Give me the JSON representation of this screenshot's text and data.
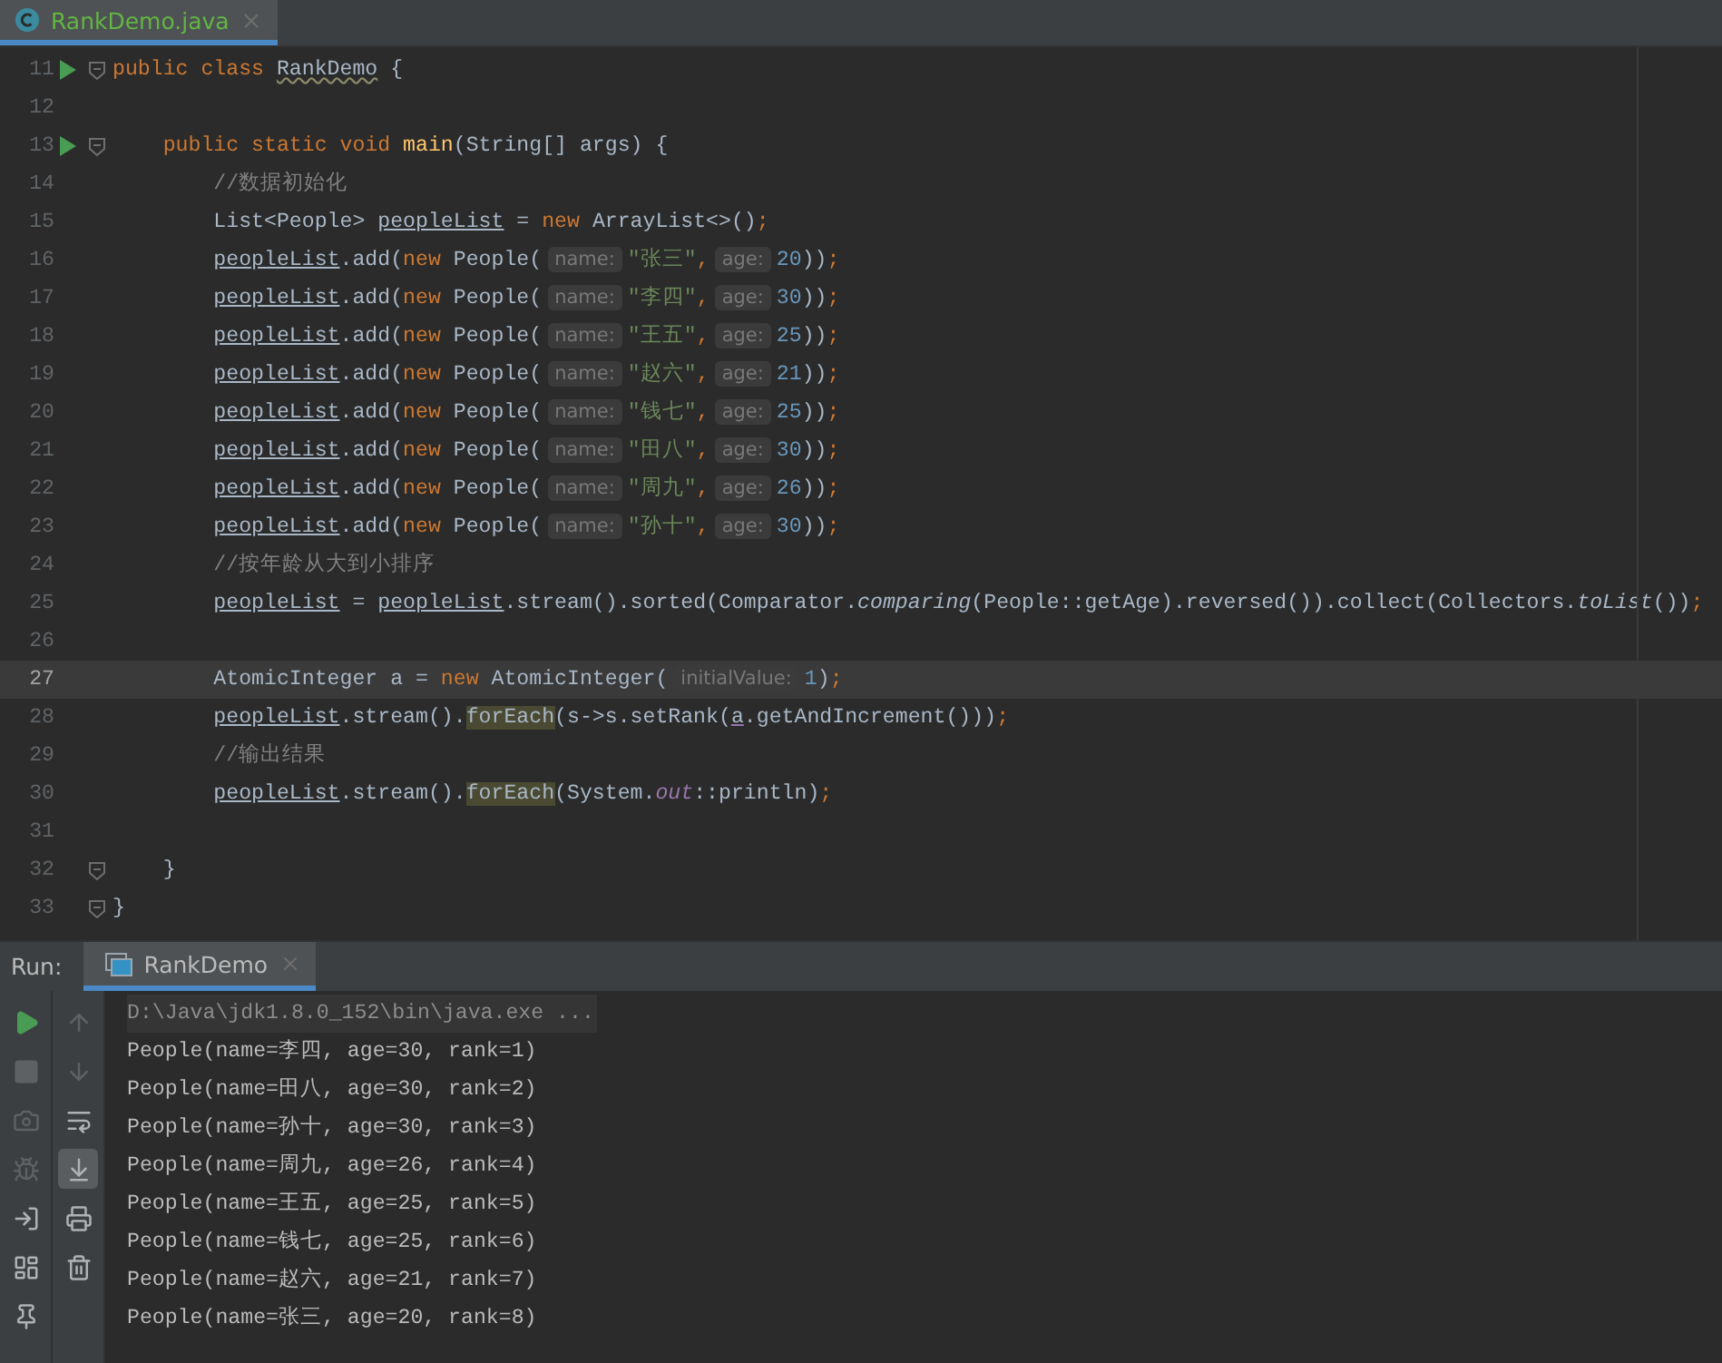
{
  "editor_tabs": [
    {
      "label": "RankDemo.java",
      "selected": true
    }
  ],
  "code_lines": [
    {
      "number": "11",
      "run": true,
      "fold": true,
      "current": false,
      "tokens": [
        {
          "kind": "kw",
          "text": "public class "
        },
        {
          "kind": "warn",
          "text": "RankDemo"
        },
        {
          "kind": "plain",
          "text": " {"
        }
      ]
    },
    {
      "number": "12",
      "run": false,
      "fold": false,
      "current": false
    },
    {
      "number": "13",
      "run": true,
      "fold": true,
      "current": false,
      "tokens": [
        {
          "kind": "kw",
          "text": "    public static void "
        },
        {
          "kind": "decl",
          "text": "main"
        },
        {
          "kind": "plain",
          "text": "(String[] args) {"
        }
      ]
    },
    {
      "number": "14",
      "run": false,
      "fold": false,
      "current": false,
      "tokens": [
        {
          "kind": "comment",
          "text": "        //数据初始化"
        }
      ]
    },
    {
      "number": "15",
      "run": false,
      "fold": false,
      "current": false,
      "tokens": [
        {
          "kind": "plain",
          "text": "        List<People> "
        },
        {
          "kind": "field",
          "text": "peopleList"
        },
        {
          "kind": "plain",
          "text": " = "
        },
        {
          "kind": "kw",
          "text": "new "
        },
        {
          "kind": "plain",
          "text": "ArrayList<>()"
        },
        {
          "kind": "kw",
          "text": ";"
        }
      ]
    },
    {
      "number": "16",
      "run": false,
      "fold": false,
      "current": false,
      "tokens": [
        {
          "kind": "field",
          "text": "        peopleList"
        },
        {
          "kind": "plain",
          "text": ".add("
        },
        {
          "kind": "kw",
          "text": "new "
        },
        {
          "kind": "plain",
          "text": "People("
        },
        {
          "kind": "hint",
          "text": "name:"
        },
        {
          "kind": "str",
          "text": "\"张三\""
        },
        {
          "kind": "kw",
          "text": ","
        },
        {
          "kind": "hint",
          "text": "age:"
        },
        {
          "kind": "num",
          "text": "20"
        },
        {
          "kind": "plain",
          "text": "))"
        },
        {
          "kind": "kw",
          "text": ";"
        }
      ]
    },
    {
      "number": "17",
      "run": false,
      "fold": false,
      "current": false,
      "tokens": [
        {
          "kind": "field",
          "text": "        peopleList"
        },
        {
          "kind": "plain",
          "text": ".add("
        },
        {
          "kind": "kw",
          "text": "new "
        },
        {
          "kind": "plain",
          "text": "People("
        },
        {
          "kind": "hint",
          "text": "name:"
        },
        {
          "kind": "str",
          "text": "\"李四\""
        },
        {
          "kind": "kw",
          "text": ","
        },
        {
          "kind": "hint",
          "text": "age:"
        },
        {
          "kind": "num",
          "text": "30"
        },
        {
          "kind": "plain",
          "text": "))"
        },
        {
          "kind": "kw",
          "text": ";"
        }
      ]
    },
    {
      "number": "18",
      "run": false,
      "fold": false,
      "current": false,
      "tokens": [
        {
          "kind": "field",
          "text": "        peopleList"
        },
        {
          "kind": "plain",
          "text": ".add("
        },
        {
          "kind": "kw",
          "text": "new "
        },
        {
          "kind": "plain",
          "text": "People("
        },
        {
          "kind": "hint",
          "text": "name:"
        },
        {
          "kind": "str",
          "text": "\"王五\""
        },
        {
          "kind": "kw",
          "text": ","
        },
        {
          "kind": "hint",
          "text": "age:"
        },
        {
          "kind": "num",
          "text": "25"
        },
        {
          "kind": "plain",
          "text": "))"
        },
        {
          "kind": "kw",
          "text": ";"
        }
      ]
    },
    {
      "number": "19",
      "run": false,
      "fold": false,
      "current": false,
      "tokens": [
        {
          "kind": "field",
          "text": "        peopleList"
        },
        {
          "kind": "plain",
          "text": ".add("
        },
        {
          "kind": "kw",
          "text": "new "
        },
        {
          "kind": "plain",
          "text": "People("
        },
        {
          "kind": "hint",
          "text": "name:"
        },
        {
          "kind": "str",
          "text": "\"赵六\""
        },
        {
          "kind": "kw",
          "text": ","
        },
        {
          "kind": "hint",
          "text": "age:"
        },
        {
          "kind": "num",
          "text": "21"
        },
        {
          "kind": "plain",
          "text": "))"
        },
        {
          "kind": "kw",
          "text": ";"
        }
      ]
    },
    {
      "number": "20",
      "run": false,
      "fold": false,
      "current": false,
      "tokens": [
        {
          "kind": "field",
          "text": "        peopleList"
        },
        {
          "kind": "plain",
          "text": ".add("
        },
        {
          "kind": "kw",
          "text": "new "
        },
        {
          "kind": "plain",
          "text": "People("
        },
        {
          "kind": "hint",
          "text": "name:"
        },
        {
          "kind": "str",
          "text": "\"钱七\""
        },
        {
          "kind": "kw",
          "text": ","
        },
        {
          "kind": "hint",
          "text": "age:"
        },
        {
          "kind": "num",
          "text": "25"
        },
        {
          "kind": "plain",
          "text": "))"
        },
        {
          "kind": "kw",
          "text": ";"
        }
      ]
    },
    {
      "number": "21",
      "run": false,
      "fold": false,
      "current": false,
      "tokens": [
        {
          "kind": "field",
          "text": "        peopleList"
        },
        {
          "kind": "plain",
          "text": ".add("
        },
        {
          "kind": "kw",
          "text": "new "
        },
        {
          "kind": "plain",
          "text": "People("
        },
        {
          "kind": "hint",
          "text": "name:"
        },
        {
          "kind": "str",
          "text": "\"田八\""
        },
        {
          "kind": "kw",
          "text": ","
        },
        {
          "kind": "hint",
          "text": "age:"
        },
        {
          "kind": "num",
          "text": "30"
        },
        {
          "kind": "plain",
          "text": "))"
        },
        {
          "kind": "kw",
          "text": ";"
        }
      ]
    },
    {
      "number": "22",
      "run": false,
      "fold": false,
      "current": false,
      "tokens": [
        {
          "kind": "field",
          "text": "        peopleList"
        },
        {
          "kind": "plain",
          "text": ".add("
        },
        {
          "kind": "kw",
          "text": "new "
        },
        {
          "kind": "plain",
          "text": "People("
        },
        {
          "kind": "hint",
          "text": "name:"
        },
        {
          "kind": "str",
          "text": "\"周九\""
        },
        {
          "kind": "kw",
          "text": ","
        },
        {
          "kind": "hint",
          "text": "age:"
        },
        {
          "kind": "num",
          "text": "26"
        },
        {
          "kind": "plain",
          "text": "))"
        },
        {
          "kind": "kw",
          "text": ";"
        }
      ]
    },
    {
      "number": "23",
      "run": false,
      "fold": false,
      "current": false,
      "tokens": [
        {
          "kind": "field",
          "text": "        peopleList"
        },
        {
          "kind": "plain",
          "text": ".add("
        },
        {
          "kind": "kw",
          "text": "new "
        },
        {
          "kind": "plain",
          "text": "People("
        },
        {
          "kind": "hint",
          "text": "name:"
        },
        {
          "kind": "str",
          "text": "\"孙十\""
        },
        {
          "kind": "kw",
          "text": ","
        },
        {
          "kind": "hint",
          "text": "age:"
        },
        {
          "kind": "num",
          "text": "30"
        },
        {
          "kind": "plain",
          "text": "))"
        },
        {
          "kind": "kw",
          "text": ";"
        }
      ]
    },
    {
      "number": "24",
      "run": false,
      "fold": false,
      "current": false,
      "tokens": [
        {
          "kind": "comment",
          "text": "        //按年龄从大到小排序"
        }
      ]
    },
    {
      "number": "25",
      "run": false,
      "fold": false,
      "current": false,
      "tokens": [
        {
          "kind": "field",
          "text": "        peopleList"
        },
        {
          "kind": "plain",
          "text": " = "
        },
        {
          "kind": "field",
          "text": "peopleList"
        },
        {
          "kind": "plain",
          "text": ".stream().sorted(Comparator."
        },
        {
          "kind": "italic",
          "text": "comparing"
        },
        {
          "kind": "plain",
          "text": "(People::getAge).reversed()).collect(Collectors."
        },
        {
          "kind": "italic",
          "text": "toList"
        },
        {
          "kind": "plain",
          "text": "())"
        },
        {
          "kind": "kw",
          "text": ";"
        }
      ]
    },
    {
      "number": "26",
      "run": false,
      "fold": false,
      "current": false
    },
    {
      "number": "27",
      "run": false,
      "fold": false,
      "current": true,
      "tokens": [
        {
          "kind": "plain",
          "text": "        AtomicInteger a = "
        },
        {
          "kind": "kw",
          "text": "new "
        },
        {
          "kind": "plain",
          "text": "AtomicInteger("
        },
        {
          "kind": "hint",
          "text": "initialValue:"
        },
        {
          "kind": "num",
          "text": "1"
        },
        {
          "kind": "plain",
          "text": ")"
        },
        {
          "kind": "kw",
          "text": ";"
        }
      ]
    },
    {
      "number": "28",
      "run": false,
      "fold": false,
      "current": false,
      "tokens": [
        {
          "kind": "field",
          "text": "        peopleList"
        },
        {
          "kind": "plain",
          "text": ".stream()."
        },
        {
          "kind": "usage",
          "text": "forEach"
        },
        {
          "kind": "plain",
          "text": "(s->s.setRank("
        },
        {
          "kind": "var",
          "text": "a"
        },
        {
          "kind": "plain",
          "text": ".getAndIncrement()))"
        },
        {
          "kind": "kw",
          "text": ";"
        }
      ]
    },
    {
      "number": "29",
      "run": false,
      "fold": false,
      "current": false,
      "tokens": [
        {
          "kind": "comment",
          "text": "        //输出结果"
        }
      ]
    },
    {
      "number": "30",
      "run": false,
      "fold": false,
      "current": false,
      "tokens": [
        {
          "kind": "field",
          "text": "        peopleList"
        },
        {
          "kind": "plain",
          "text": ".stream()."
        },
        {
          "kind": "usage",
          "text": "forEach"
        },
        {
          "kind": "plain",
          "text": "(System."
        },
        {
          "kind": "static",
          "text": "out"
        },
        {
          "kind": "plain",
          "text": "::println)"
        },
        {
          "kind": "kw",
          "text": ";"
        }
      ]
    },
    {
      "number": "31",
      "run": false,
      "fold": false,
      "current": false
    },
    {
      "number": "32",
      "run": false,
      "fold": true,
      "current": false,
      "tokens": [
        {
          "kind": "plain",
          "text": "    }"
        }
      ]
    },
    {
      "number": "33",
      "run": false,
      "fold": true,
      "current": false,
      "tokens": [
        {
          "kind": "plain",
          "text": "}"
        }
      ]
    }
  ],
  "run_panel": {
    "label": "Run:",
    "tabs": [
      {
        "label": "RankDemo",
        "selected": true
      }
    ],
    "left_tools": [
      {
        "kind": "run",
        "disabled": false
      },
      {
        "kind": "stop",
        "disabled": true
      },
      {
        "kind": "camera",
        "disabled": true
      },
      {
        "kind": "debug",
        "disabled": true
      },
      {
        "kind": "login",
        "disabled": false
      },
      {
        "kind": "layout",
        "disabled": false
      },
      {
        "kind": "pin",
        "disabled": false
      }
    ],
    "console_tools": [
      {
        "kind": "up",
        "disabled": true,
        "selected": false
      },
      {
        "kind": "down",
        "disabled": true,
        "selected": false
      },
      {
        "kind": "wrap",
        "disabled": false,
        "selected": false
      },
      {
        "kind": "scroll-end",
        "disabled": false,
        "selected": true
      },
      {
        "kind": "print",
        "disabled": false,
        "selected": false
      },
      {
        "kind": "trash",
        "disabled": false,
        "selected": false
      }
    ],
    "console_lines": [
      {
        "kind": "command",
        "text": "D:\\Java\\jdk1.8.0_152\\bin\\java.exe ..."
      },
      {
        "kind": "output",
        "text": "People(name=李四, age=30, rank=1)"
      },
      {
        "kind": "output",
        "text": "People(name=田八, age=30, rank=2)"
      },
      {
        "kind": "output",
        "text": "People(name=孙十, age=30, rank=3)"
      },
      {
        "kind": "output",
        "text": "People(name=周九, age=26, rank=4)"
      },
      {
        "kind": "output",
        "text": "People(name=王五, age=25, rank=5)"
      },
      {
        "kind": "output",
        "text": "People(name=钱七, age=25, rank=6)"
      },
      {
        "kind": "output",
        "text": "People(name=赵六, age=21, rank=7)"
      },
      {
        "kind": "output",
        "text": "People(name=张三, age=20, rank=8)"
      }
    ]
  }
}
